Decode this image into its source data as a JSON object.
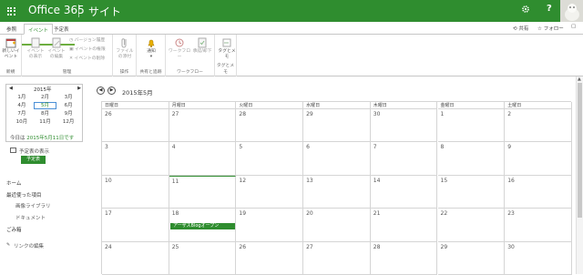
{
  "suitebar": {
    "brand": "Office 365",
    "site_label": "サイト",
    "help": "?"
  },
  "ribbon_tabs": [
    "参照",
    "イベント",
    "予定表"
  ],
  "ribbon_right": {
    "share": "共有",
    "follow": "フォロー"
  },
  "ribbon": {
    "new_event": "新しいイベント",
    "group_new": "新規",
    "view_event": "イベントの表示",
    "edit_event": "イベントの編集",
    "version_history": "バージョン履歴",
    "event_permissions": "イベントの権限",
    "delete_event": "イベントの削除",
    "group_manage": "管理",
    "attach_file": "ファイルの添付",
    "group_actions": "操作",
    "alert": "通知",
    "group_share_track": "共有と追跡",
    "workflow": "ワークフロー",
    "approve_reject": "承認/却下",
    "group_workflow": "ワークフロー",
    "tags_notes": "タグとメモ",
    "group_tags": "タグとメモ"
  },
  "minical": {
    "year_title": "2015年",
    "months": [
      "1月",
      "2月",
      "3月",
      "4月",
      "5月",
      "6月",
      "7月",
      "8月",
      "9月",
      "10月",
      "11月",
      "12月"
    ],
    "selected_index": 4,
    "today_label": "今日は ",
    "today_link": "2015年5月11日です"
  },
  "left_nav": {
    "show_calendars": "予定表の表示",
    "calendar_chip": "予定表",
    "home": "ホーム",
    "recent": "最近使った項目",
    "image_library": "画像ライブラリ",
    "documents": "ドキュメント",
    "recycle_bin": "ごみ箱",
    "edit_links": "リンクの編集"
  },
  "calendar": {
    "month_title": "2015年5月",
    "weekdays": [
      "日曜日",
      "月曜日",
      "火曜日",
      "水曜日",
      "木曜日",
      "金曜日",
      "土曜日"
    ],
    "weeks": [
      [
        "26",
        "27",
        "28",
        "29",
        "30",
        "1",
        "2"
      ],
      [
        "3",
        "4",
        "5",
        "6",
        "7",
        "8",
        "9"
      ],
      [
        "10",
        "11",
        "12",
        "13",
        "14",
        "15",
        "16"
      ],
      [
        "17",
        "18",
        "19",
        "20",
        "21",
        "22",
        "23"
      ],
      [
        "24",
        "25",
        "26",
        "27",
        "28",
        "29",
        "30"
      ]
    ],
    "event_label": "アーザスBlogオープン"
  },
  "colors": {
    "accent": "#2f8d2f",
    "grid": "#d5d5d5"
  }
}
